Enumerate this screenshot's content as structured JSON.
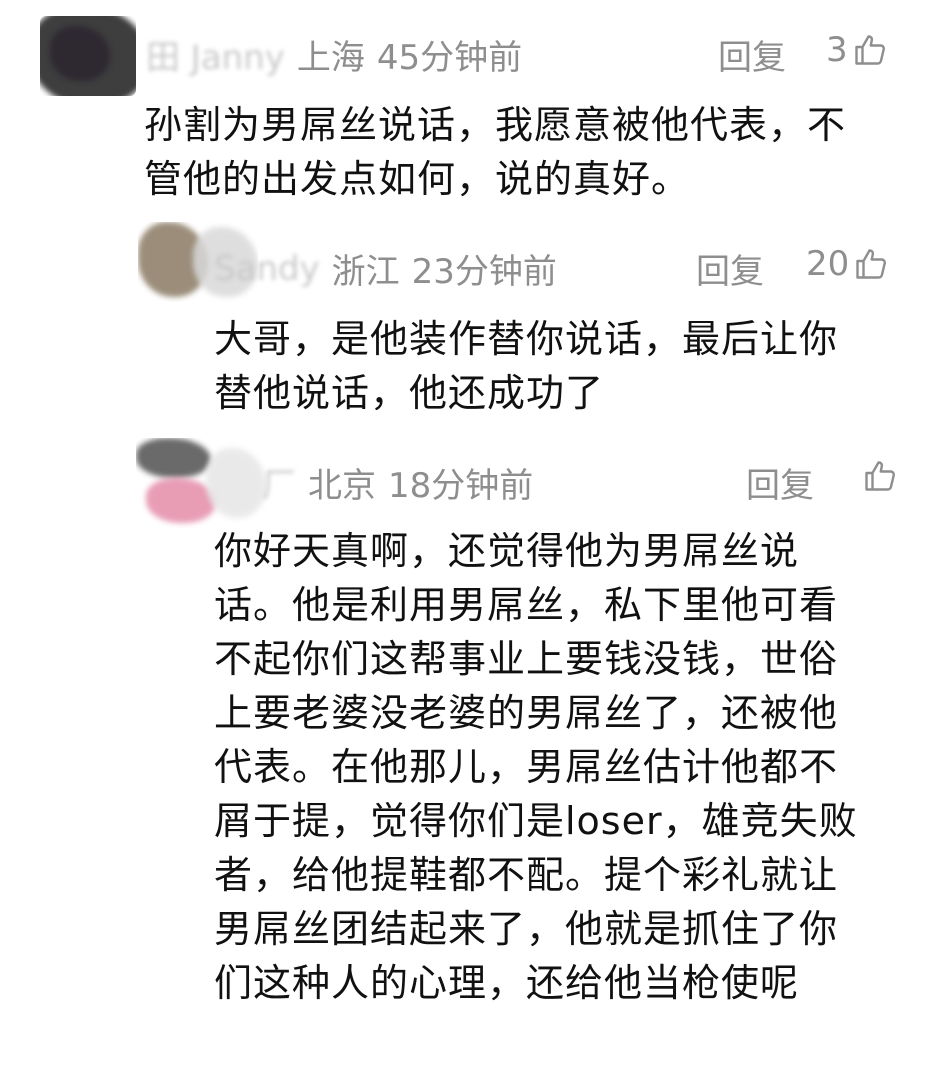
{
  "comments": [
    {
      "username": "田 Janny",
      "location": "上海",
      "time": "45分钟前",
      "reply_label": "回复",
      "likes": "3",
      "text_lines": [
        "孙割为男屌丝说话，我愿意被他代表，不",
        "管他的出发点如何，说的真好。"
      ]
    },
    {
      "username": "Sandy",
      "location": "浙江",
      "time": "23分钟前",
      "reply_label": "回复",
      "likes": "20",
      "text_lines": [
        "大哥，是他装作替你说话，最后让你",
        "替他说话，他还成功了"
      ]
    },
    {
      "username": "厂",
      "location": "北京",
      "time": "18分钟前",
      "reply_label": "回复",
      "likes": "",
      "text_lines": [
        "你好天真啊，还觉得他为男屌丝说",
        "话。他是利用男屌丝，私下里他可看",
        "不起你们这帮事业上要钱没钱，世俗",
        "上要老婆没老婆的男屌丝了，还被他",
        "代表。在他那儿，男屌丝估计他都不",
        "屑于提，觉得你们是loser，雄竞失败",
        "者，给他提鞋都不配。提个彩礼就让",
        "男屌丝团结起来了，他就是抓住了你",
        "们这种人的心理，还给他当枪使呢"
      ]
    }
  ],
  "icons": {
    "like": "thumbs-up-icon"
  },
  "colors": {
    "meta_gray": "#8e8e8e",
    "text": "#111111"
  }
}
